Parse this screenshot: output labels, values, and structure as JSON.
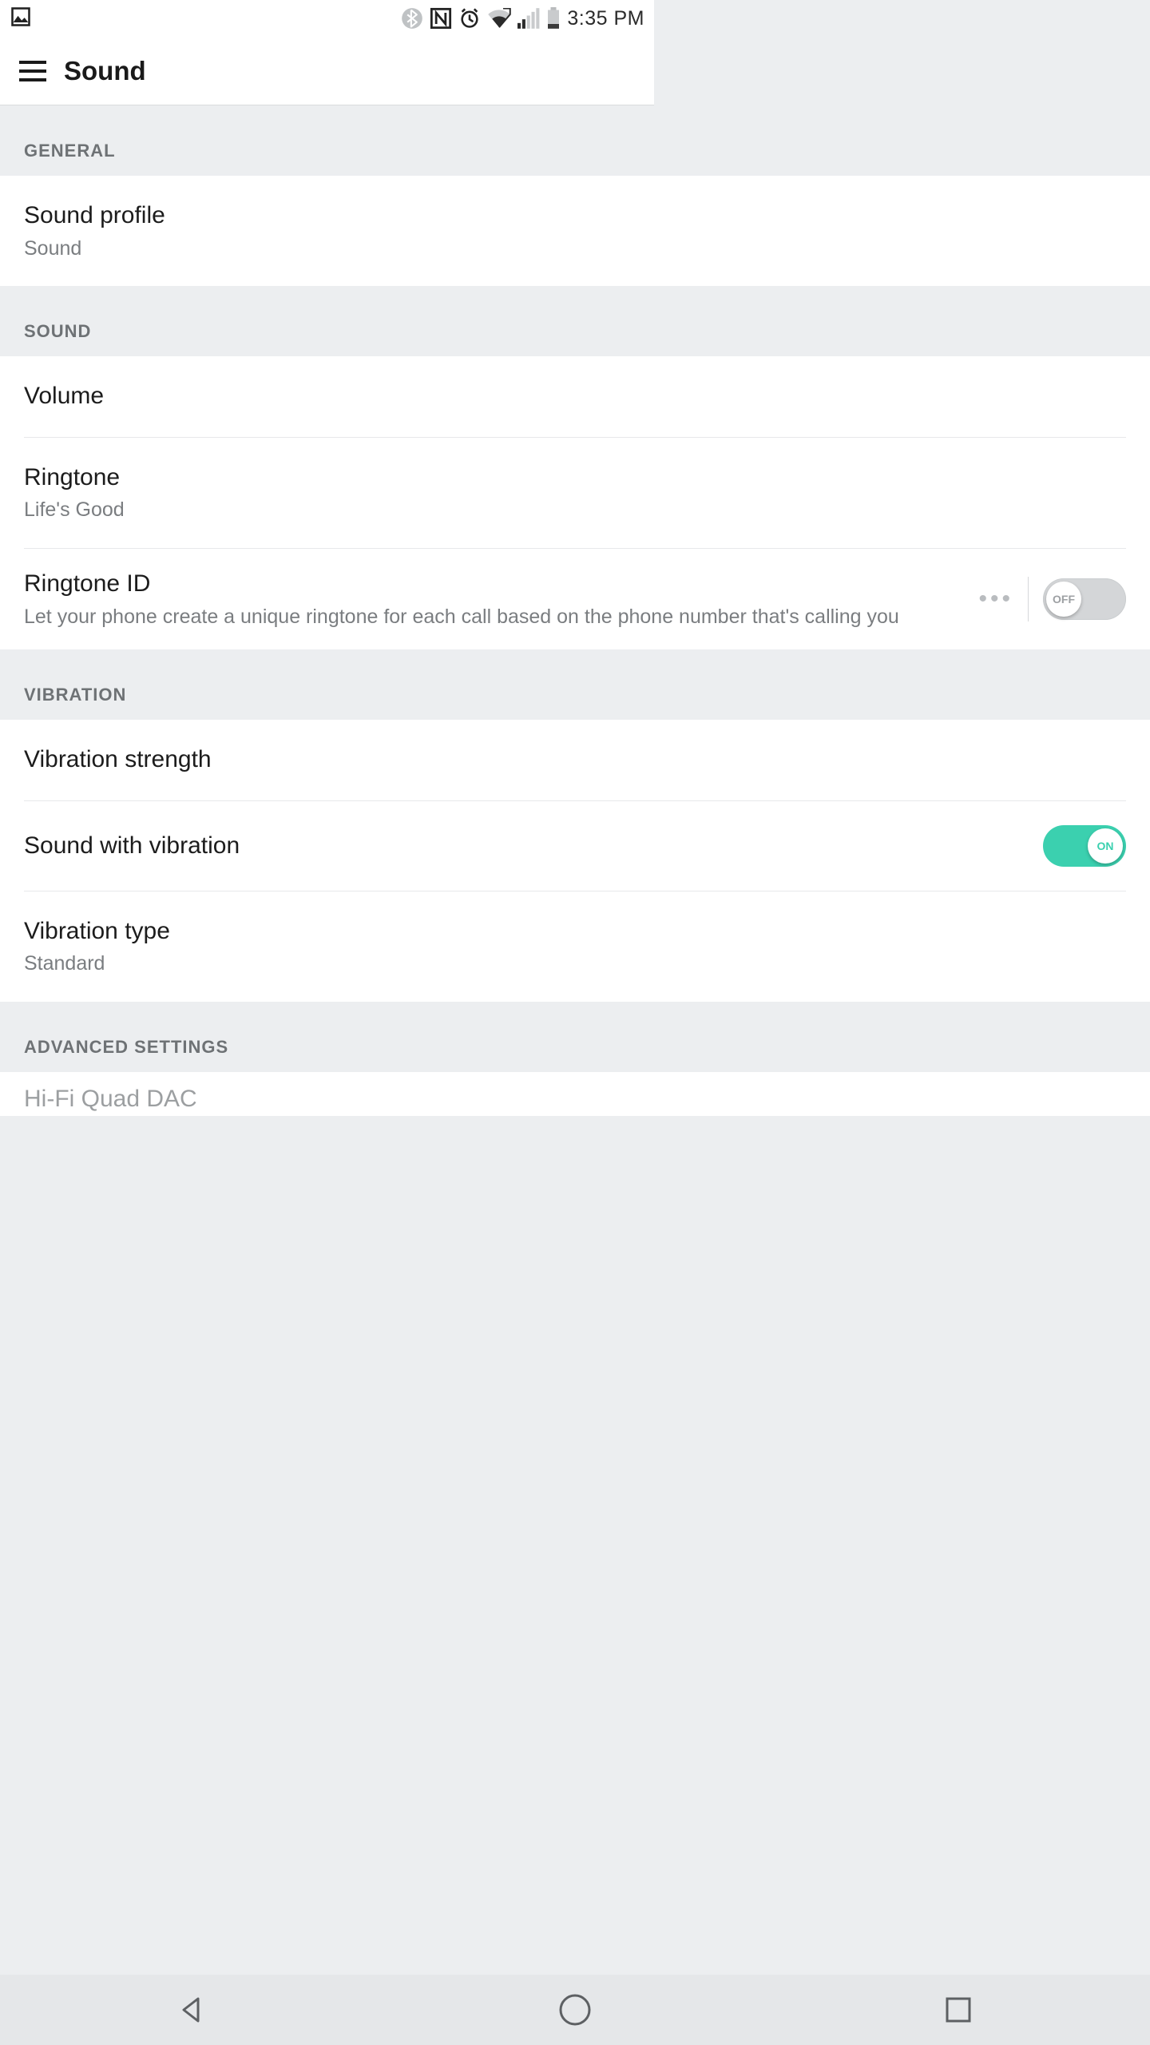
{
  "status": {
    "time": "3:35 PM"
  },
  "header": {
    "title": "Sound"
  },
  "sections": {
    "general": {
      "label": "GENERAL",
      "sound_profile": {
        "title": "Sound profile",
        "value": "Sound"
      }
    },
    "sound": {
      "label": "SOUND",
      "volume": {
        "title": "Volume"
      },
      "ringtone": {
        "title": "Ringtone",
        "value": "Life's Good"
      },
      "ringtone_id": {
        "title": "Ringtone ID",
        "desc": "Let your phone create a unique ringtone for each call based on the phone number that's calling you",
        "toggle": "OFF"
      }
    },
    "vibration": {
      "label": "VIBRATION",
      "strength": {
        "title": "Vibration strength"
      },
      "sound_with_vibration": {
        "title": "Sound with vibration",
        "toggle": "ON"
      },
      "type": {
        "title": "Vibration type",
        "value": "Standard"
      }
    },
    "advanced": {
      "label": "ADVANCED SETTINGS",
      "hifi": {
        "title": "Hi-Fi Quad DAC"
      }
    }
  }
}
